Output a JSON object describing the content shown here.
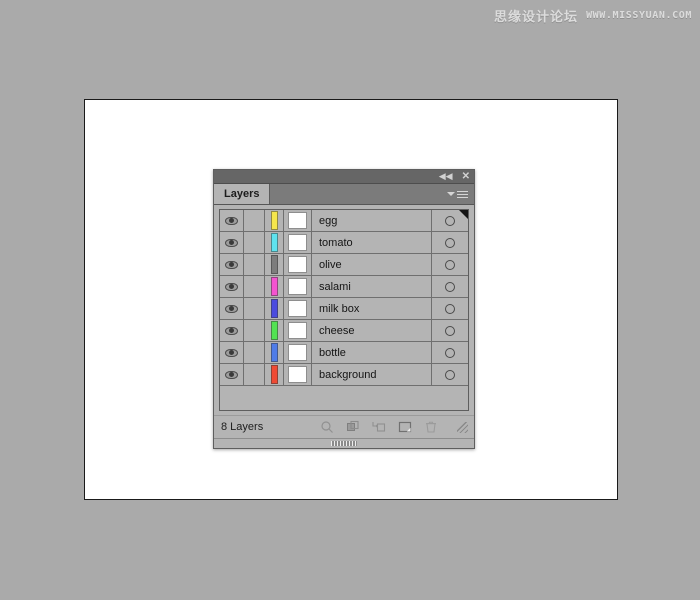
{
  "watermark": {
    "chinese": "思缘设计论坛",
    "url": "WWW.MISSYUAN.COM"
  },
  "panel": {
    "titlebar": {
      "collapse_icon": "double-left-arrow-icon",
      "collapse_glyph": "◀◀",
      "close_icon": "close-icon",
      "close_glyph": "✕"
    },
    "tab_label": "Layers",
    "menu_icon": "panel-menu-icon",
    "footer": {
      "count_label": "8 Layers",
      "icons": [
        {
          "name": "locate-object-icon",
          "title": "Locate Object"
        },
        {
          "name": "clipping-mask-icon",
          "title": "Make/Release Clipping Mask"
        },
        {
          "name": "new-sublayer-icon",
          "title": "Create New Sublayer"
        },
        {
          "name": "new-layer-icon",
          "title": "Create New Layer"
        },
        {
          "name": "delete-layer-icon",
          "title": "Delete Selection"
        }
      ],
      "resize_grip": "resize-grip-icon"
    }
  },
  "layers": [
    {
      "name": "egg",
      "color": "#f5e64b",
      "visible": true,
      "locked": false,
      "selected": true,
      "target": false
    },
    {
      "name": "tomato",
      "color": "#5ee2ee",
      "visible": true,
      "locked": false,
      "selected": false,
      "target": false
    },
    {
      "name": "olive",
      "color": "#7d7d7d",
      "visible": true,
      "locked": false,
      "selected": false,
      "target": false
    },
    {
      "name": "salami",
      "color": "#f453d0",
      "visible": true,
      "locked": false,
      "selected": false,
      "target": false
    },
    {
      "name": "milk box",
      "color": "#4b4bdf",
      "visible": true,
      "locked": false,
      "selected": false,
      "target": false
    },
    {
      "name": "cheese",
      "color": "#52e252",
      "visible": true,
      "locked": false,
      "selected": false,
      "target": false
    },
    {
      "name": "bottle",
      "color": "#4f7ce8",
      "visible": true,
      "locked": false,
      "selected": false,
      "target": false
    },
    {
      "name": "background",
      "color": "#ef4a34",
      "visible": true,
      "locked": false,
      "selected": false,
      "target": false
    }
  ],
  "colors": {
    "desktop": "#aaaaaa",
    "artboard": "#ffffff",
    "panel_bg": "#b4b4b4",
    "panel_chrome": "#666666",
    "tabstrip": "#7b7b7b",
    "row_divider": "#6f6f6f"
  }
}
